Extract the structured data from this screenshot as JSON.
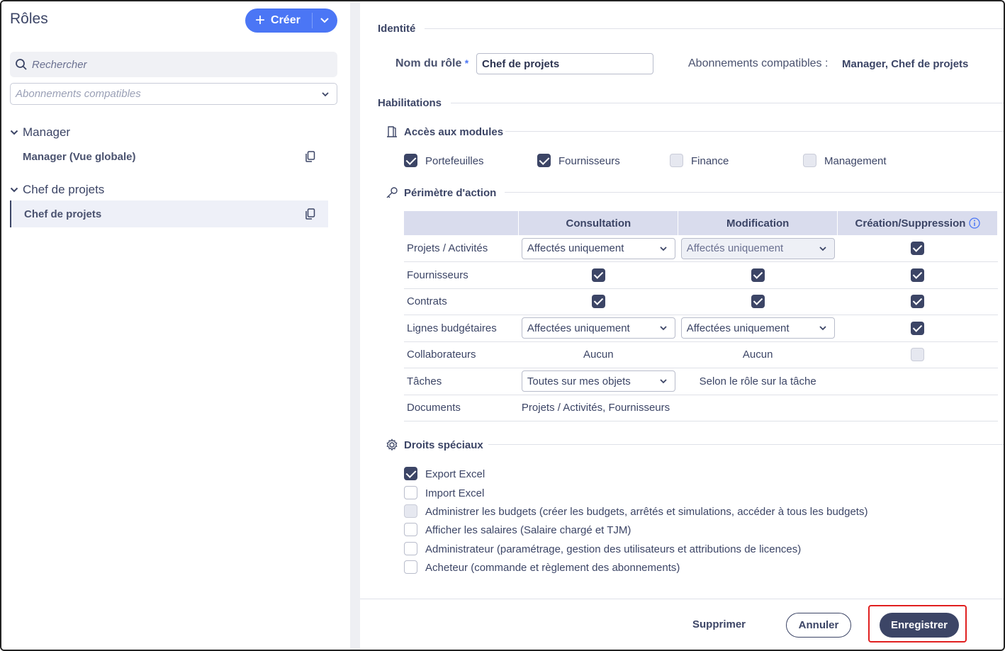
{
  "sidebar": {
    "title": "Rôles",
    "create_label": "Créer",
    "search_placeholder": "Rechercher",
    "filter_placeholder": "Abonnements compatibles",
    "groups": [
      {
        "label": "Manager",
        "items": [
          {
            "label": "Manager (Vue globale)",
            "active": false
          }
        ]
      },
      {
        "label": "Chef de projets",
        "items": [
          {
            "label": "Chef de projets",
            "active": true
          }
        ]
      }
    ]
  },
  "identity": {
    "section": "Identité",
    "name_label": "Nom du rôle",
    "required_mark": "*",
    "name_value": "Chef de projets",
    "compat_label": "Abonnements compatibles :",
    "compat_value": "Manager, Chef de projets"
  },
  "habilitations": {
    "section": "Habilitations",
    "modules": {
      "title": "Accès aux modules",
      "items": [
        {
          "label": "Portefeuilles",
          "checked": true
        },
        {
          "label": "Fournisseurs",
          "checked": true
        },
        {
          "label": "Finance",
          "checked": false
        },
        {
          "label": "Management",
          "checked": false
        }
      ]
    },
    "perimetre": {
      "title": "Périmètre d'action",
      "columns": [
        "Consultation",
        "Modification",
        "Création/Suppression"
      ],
      "rows": [
        {
          "label": "Projets / Activités",
          "consultation": "Affectés uniquement",
          "modification": "Affectés uniquement",
          "creation": "checked"
        },
        {
          "label": "Fournisseurs",
          "consultation": "checked",
          "modification": "checked",
          "creation": "checked"
        },
        {
          "label": "Contrats",
          "consultation": "checked",
          "modification": "checked",
          "creation": "checked"
        },
        {
          "label": "Lignes budgétaires",
          "consultation": "Affectées uniquement",
          "modification": "Affectées uniquement",
          "creation": "checked"
        },
        {
          "label": "Collaborateurs",
          "consultation": "Aucun",
          "modification": "Aucun",
          "creation": "disabled"
        },
        {
          "label": "Tâches",
          "consultation": "Toutes sur mes objets",
          "modification": "Selon le rôle sur la tâche",
          "creation": ""
        },
        {
          "label": "Documents",
          "consultation": "Projets / Activités, Fournisseurs",
          "modification": "",
          "creation": ""
        }
      ]
    },
    "droits": {
      "title": "Droits spéciaux",
      "items": [
        {
          "label": "Export Excel",
          "state": "checked"
        },
        {
          "label": "Import Excel",
          "state": "unchecked"
        },
        {
          "label": "Administrer les budgets (créer les budgets, arrêtés et simulations, accéder à tous les budgets)",
          "state": "disabled"
        },
        {
          "label": "Afficher les salaires (Salaire chargé et TJM)",
          "state": "unchecked"
        },
        {
          "label": "Administrateur (paramétrage, gestion des utilisateurs et attributions de licences)",
          "state": "unchecked"
        },
        {
          "label": "Acheteur (commande et règlement des abonnements)",
          "state": "unchecked"
        }
      ]
    }
  },
  "footer": {
    "delete_label": "Supprimer",
    "cancel_label": "Annuler",
    "save_label": "Enregistrer"
  },
  "colors": {
    "primary": "#4b76f5",
    "dark": "#3c4566",
    "highlight": "#e02020"
  }
}
